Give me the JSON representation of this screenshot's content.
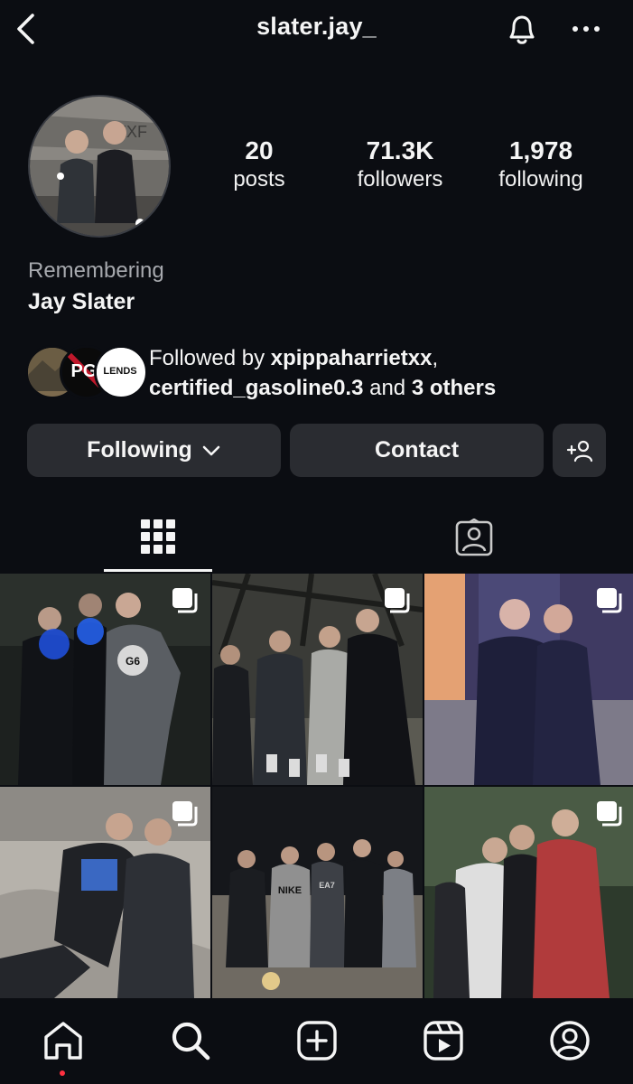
{
  "header": {
    "username": "slater.jay_",
    "icons": [
      "back-arrow-icon",
      "bell-icon",
      "more-icon"
    ]
  },
  "profile": {
    "stats": [
      {
        "value": "20",
        "label": "posts"
      },
      {
        "value": "71.3K",
        "label": "followers"
      },
      {
        "value": "1,978",
        "label": "following"
      }
    ],
    "bio_line1": "Remembering",
    "bio_line2": "Jay Slater"
  },
  "followed_by": {
    "prefix": "Followed by ",
    "user1": "xpippaharrietxx",
    "sep": ",",
    "user2": "certified_gasoline0.3",
    "and": " and ",
    "others": "3 others",
    "avatar_texts": [
      "PG",
      "LENDS"
    ]
  },
  "actions": {
    "following_label": "Following",
    "contact_label": "Contact"
  },
  "tabs": [
    "grid-icon",
    "tagged-icon"
  ],
  "posts": [
    {
      "multiple": true
    },
    {
      "multiple": true
    },
    {
      "multiple": true
    },
    {
      "multiple": true
    },
    {
      "multiple": false
    },
    {
      "multiple": true
    }
  ],
  "post_texts": {
    "ball": "G6",
    "shirt": "NIKE",
    "shirt2": "EA7"
  },
  "nav": [
    "home-icon",
    "search-icon",
    "create-icon",
    "reels-icon",
    "profile-icon"
  ],
  "colors": {
    "background": "#0b0d12",
    "button": "#2a2c31",
    "notification_dot": "#ff3040"
  }
}
